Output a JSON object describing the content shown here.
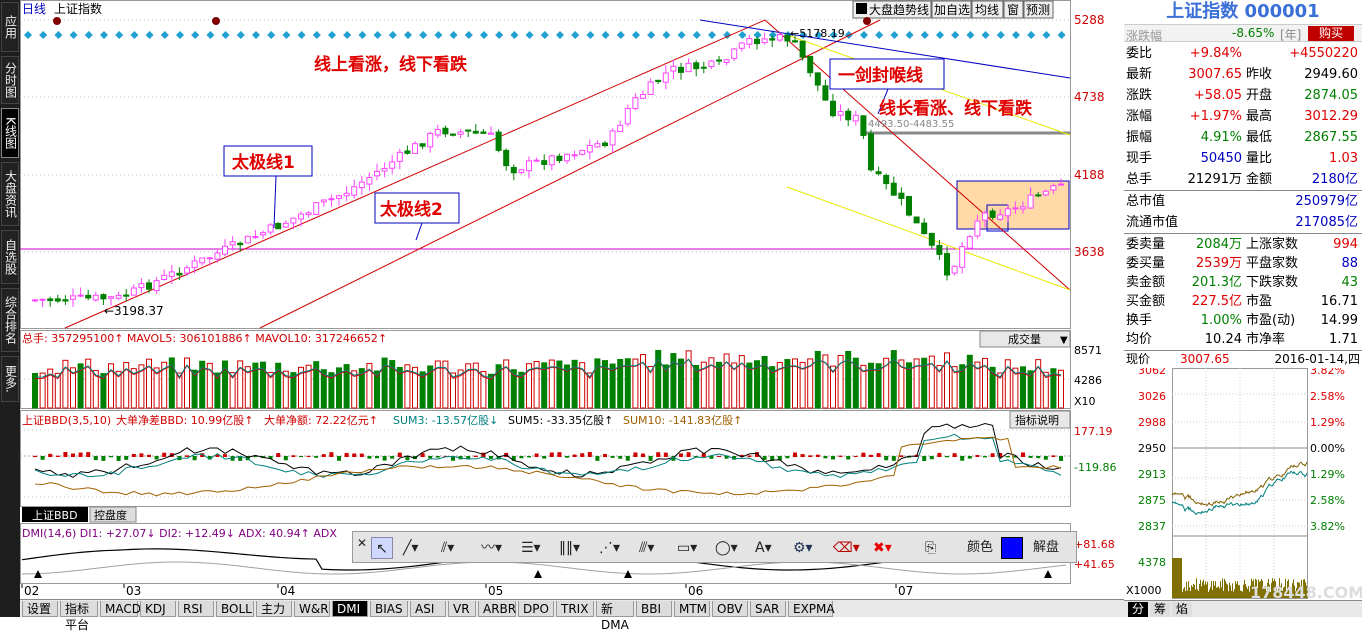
{
  "nav": {
    "items": [
      {
        "label": "应用"
      },
      {
        "label": "分时图"
      },
      {
        "label": "K线图"
      },
      {
        "label": "大盘资讯"
      },
      {
        "label": "自选股"
      },
      {
        "label": "综合排名"
      },
      {
        "label": "更多."
      }
    ]
  },
  "chart_header": {
    "period": "日线",
    "index_name": "上证指数",
    "buttons": [
      "大盘趋势线",
      "加自选",
      "均线",
      "窗",
      "预测"
    ]
  },
  "annotations": {
    "up_down": "线上看涨，线下看跌",
    "taiji1": "太极线1",
    "taiji2": "太极线2",
    "yijian": "一剑封喉线",
    "long_line": "线长看涨、线下看跌",
    "low_mark": "←3198.37",
    "high_mark": "←5178.19",
    "mid_mark": "4493.50-4483.55"
  },
  "price_axis": [
    "5288",
    "4738",
    "4188",
    "3638"
  ],
  "volume": {
    "header": "总手: 357295100↑  MAVOL5: 306101886↑  MAVOL10: 317246652↑",
    "select": "成交量",
    "axis": [
      "8571",
      "4286",
      "X10"
    ]
  },
  "bbd": {
    "header_name": "上证BBD(3,5,10)",
    "header_parts": [
      "大单净差BBD: 10.99亿股↑",
      "大单净额: 72.22亿元↑",
      "SUM3: -13.57亿股↓",
      "SUM5: -33.35亿股↑",
      "SUM10: -141.83亿股↑"
    ],
    "help": "指标说明",
    "axis": [
      "177.19",
      "-119.86"
    ],
    "tabs": [
      "上证BBD",
      "控盘度"
    ]
  },
  "dmi": {
    "header": "DMI(14,6) DI1: +27.07↓  DI2: +12.49↓  ADX: 40.94↑  ADX",
    "axis": [
      "+81.68",
      "+41.65"
    ]
  },
  "date_axis": [
    "02",
    "03",
    "04",
    "05",
    "06",
    "07"
  ],
  "toolbar": {
    "color_label": "颜色",
    "unlock_label": "解盘"
  },
  "bottom_tabs": [
    "设置",
    "指标平台",
    "MACD",
    "KDJ",
    "RSI",
    "BOLL",
    "主力",
    "W&R",
    "DMI",
    "BIAS",
    "ASI",
    "VR",
    "ARBR",
    "DPO",
    "TRIX",
    "新DMA",
    "BBI",
    "MTM",
    "OBV",
    "SAR",
    "EXPMA"
  ],
  "quote": {
    "title": "上证指数 000001",
    "sub_change": "-8.65%",
    "sub_unit": "[年]",
    "buy_label": "购买",
    "rows": [
      {
        "l1": "委比",
        "v1": "+9.84%",
        "c1": "red",
        "l2": "",
        "v2": "+4550220",
        "c2": "red"
      },
      {
        "l1": "最新",
        "v1": "3007.65",
        "c1": "red",
        "l2": "昨收",
        "v2": "2949.60",
        "c2": "blk"
      },
      {
        "l1": "涨跌",
        "v1": "+58.05",
        "c1": "red",
        "l2": "开盘",
        "v2": "2874.05",
        "c2": "grn"
      },
      {
        "l1": "涨幅",
        "v1": "+1.97%",
        "c1": "red",
        "l2": "最高",
        "v2": "3012.29",
        "c2": "red"
      },
      {
        "l1": "振幅",
        "v1": "4.91%",
        "c1": "grn",
        "l2": "最低",
        "v2": "2867.55",
        "c2": "grn"
      },
      {
        "l1": "现手",
        "v1": "50450",
        "c1": "blu",
        "l2": "量比",
        "v2": "1.03",
        "c2": "red"
      },
      {
        "l1": "总手",
        "v1": "21291万",
        "c1": "blk",
        "l2": "金额",
        "v2": "2180亿",
        "c2": "blu"
      }
    ],
    "cap_rows": [
      {
        "l": "总市值",
        "v": "250979亿"
      },
      {
        "l": "流通市值",
        "v": "217085亿"
      }
    ],
    "stat_rows": [
      {
        "l1": "委卖量",
        "v1": "2084万",
        "c1": "grn",
        "l2": "上涨家数",
        "v2": "994",
        "c2": "red"
      },
      {
        "l1": "委买量",
        "v1": "2539万",
        "c1": "red",
        "l2": "平盘家数",
        "v2": "88",
        "c2": "blu"
      },
      {
        "l1": "卖金额",
        "v1": "201.3亿",
        "c1": "grn",
        "l2": "下跌家数",
        "v2": "43",
        "c2": "grn"
      },
      {
        "l1": "买金额",
        "v1": "227.5亿",
        "c1": "red",
        "l2": "市盈",
        "v2": "16.71",
        "c2": "blk"
      },
      {
        "l1": "换手",
        "v1": "1.00%",
        "c1": "grn",
        "l2": "市盈(动)",
        "v2": "14.99",
        "c2": "blk"
      },
      {
        "l1": "均价",
        "v1": "10.24",
        "c1": "blk",
        "l2": "市净率",
        "v2": "1.71",
        "c2": "blk"
      }
    ],
    "now_label": "现价",
    "now_value": "3007.65",
    "date": "2016-01-14,四",
    "mini_left": [
      "3062",
      "3026",
      "2988",
      "2950",
      "2913",
      "2875",
      "2837"
    ],
    "mini_right": [
      "3.82%",
      "2.58%",
      "1.29%",
      "0.00%",
      "1.29%",
      "2.58%",
      "3.82%"
    ],
    "mini_vol": "4378",
    "mini_x": "X1000",
    "bottom_tabs": [
      "分",
      "筹",
      "焰"
    ],
    "watermark": "178448.COM"
  },
  "colors": {
    "up": "#ff44ff",
    "down": "#008000",
    "accent_red": "#e00000",
    "blue": "#0000c0"
  }
}
